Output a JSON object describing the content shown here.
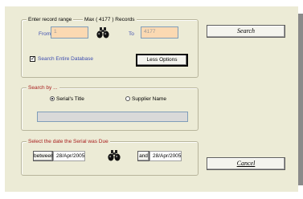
{
  "record_range": {
    "legend": "Enter record range",
    "max_label": "Max ( 4177 ) Records",
    "from_label": "From",
    "from_value": "1",
    "to_label": "To",
    "to_value": "4177",
    "search_entire_label": "Search Entire Database",
    "search_entire_checked": true,
    "less_options_label": "Less Options"
  },
  "search_by": {
    "legend": "Search by ...",
    "option_title": "Serial's Title",
    "option_supplier": "Supplier Name",
    "selected": "Serial's Title",
    "query_value": ""
  },
  "due_date": {
    "legend": "Select the date the Serial was Due",
    "between_label": "between",
    "between_value": "28/Apr/2005",
    "and_label": "and",
    "and_value": "28/Apr/2005"
  },
  "buttons": {
    "search_label": "Search",
    "cancel_label": "Cancel"
  },
  "icons": {
    "binoculars": "binoculars-icon"
  }
}
